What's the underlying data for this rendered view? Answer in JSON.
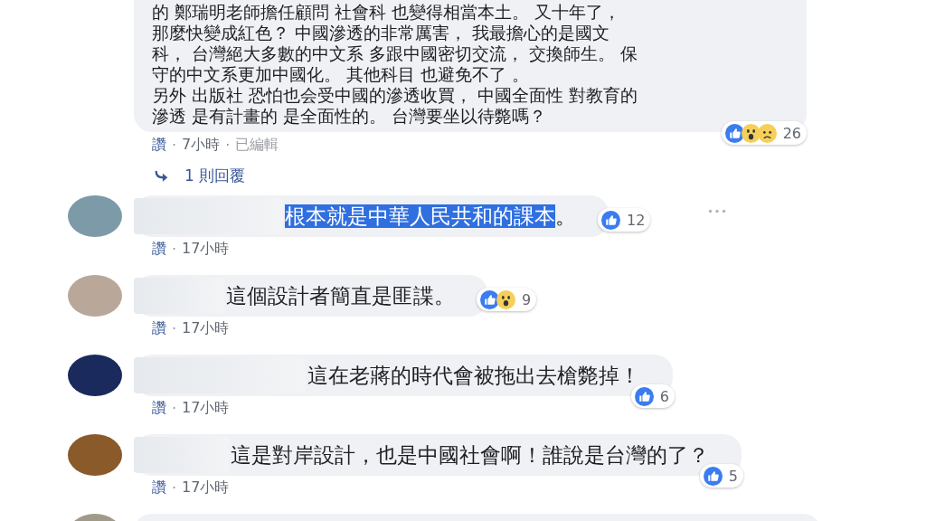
{
  "top_comment": {
    "lines": [
      "的 鄭瑞明老師擔任顧問 社會科 也變得相當本土。 又十年了，",
      "那麼快變成紅色？ 中國滲透的非常厲害， 我最擔心的是國文",
      "科， 台灣絕大多數的中文系 多跟中國密切交流， 交換師生。 保",
      "守的中文系更加中國化。 其他科目 也避免不了 。",
      "另外 出版社 恐怕也会受中國的滲透收買， 中國全面性 對教育的",
      "滲透 是有計畫的 是全面性的。 台灣要坐以待斃嗎？"
    ],
    "reactions": [
      {
        "kind": "like"
      },
      {
        "kind": "wow"
      },
      {
        "kind": "sad"
      }
    ],
    "reaction_count": "26",
    "separator": "·",
    "actions": [
      {
        "kind": "like",
        "label": "讚"
      },
      {
        "kind": "time",
        "label": "7小時"
      },
      {
        "kind": "edited",
        "label": "已編輯"
      }
    ]
  },
  "replies_link": {
    "label": "1 則回覆"
  },
  "comments": [
    {
      "text": "根本就是中華人民共和的課本",
      "end": "。",
      "selected": true,
      "reactions": [
        {
          "kind": "like"
        }
      ],
      "reaction_count": "12",
      "separator": "·",
      "actions": [
        {
          "kind": "like",
          "label": "讚"
        },
        {
          "kind": "time",
          "label": "17小時"
        }
      ]
    },
    {
      "text": "這個設計者簡直是匪諜",
      "end": "。",
      "selected": false,
      "reactions": [
        {
          "kind": "like"
        },
        {
          "kind": "wow"
        }
      ],
      "reaction_count": "9",
      "separator": "·",
      "actions": [
        {
          "kind": "like",
          "label": "讚"
        },
        {
          "kind": "time",
          "label": "17小時"
        }
      ]
    },
    {
      "text": "這在老蔣的時代會被拖出去槍斃掉",
      "end": "！",
      "selected": false,
      "reactions": [
        {
          "kind": "like"
        }
      ],
      "reaction_count": "6",
      "separator": "·",
      "actions": [
        {
          "kind": "like",
          "label": "讚"
        },
        {
          "kind": "time",
          "label": "17小時"
        }
      ]
    },
    {
      "text": "這是對岸設計，也是中國社會啊！誰說是台灣的了",
      "end": "？",
      "selected": false,
      "reactions": [
        {
          "kind": "like"
        }
      ],
      "reaction_count": "5",
      "separator": "·",
      "actions": [
        {
          "kind": "like",
          "label": "讚"
        },
        {
          "kind": "time",
          "label": "17小時"
        }
      ]
    }
  ]
}
